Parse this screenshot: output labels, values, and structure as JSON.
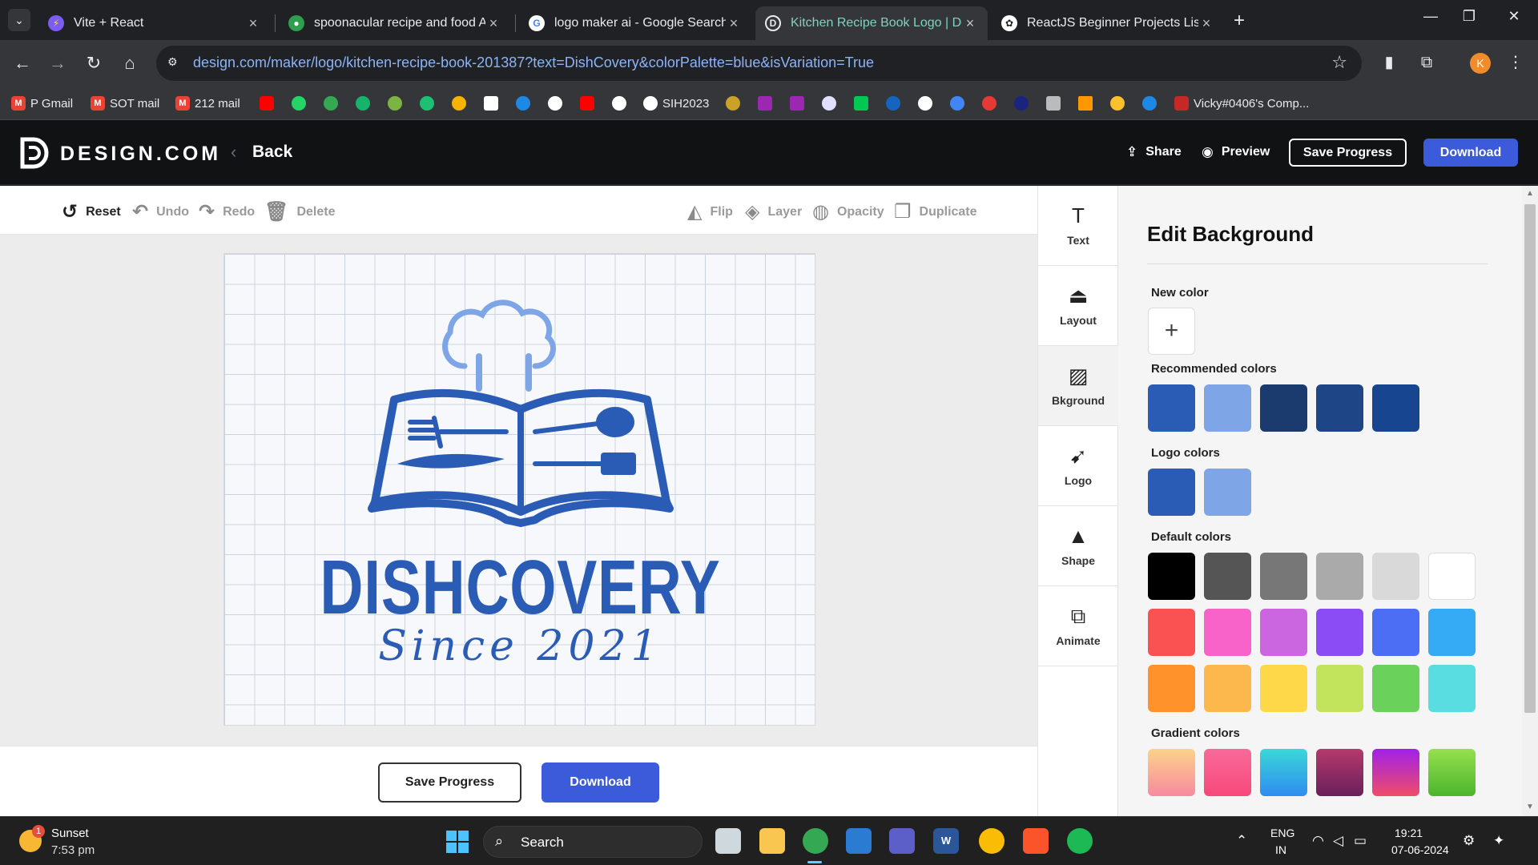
{
  "browser": {
    "tabs": [
      {
        "label": "Vite + React",
        "favicon": "vite-icon",
        "active": false
      },
      {
        "label": "spoonacular recipe and food API",
        "favicon": "spoonacular-icon",
        "active": false
      },
      {
        "label": "logo maker ai - Google Search",
        "favicon": "google-icon",
        "active": false
      },
      {
        "label": "Kitchen Recipe Book Logo | Design.com",
        "favicon": "design-com-icon",
        "active": true
      },
      {
        "label": "ReactJS Beginner Projects List",
        "favicon": "chatgpt-icon",
        "active": false
      }
    ],
    "url_host": "design.com",
    "url_path": "/maker/logo/kitchen-recipe-book-201387?text=DishCovery&colorPalette=blue&isVariation=True",
    "profile_initial": "K",
    "bookmarks": [
      {
        "label": "P Gmail",
        "icon": "gmail-icon"
      },
      {
        "label": "SOT mail",
        "icon": "gmail-icon"
      },
      {
        "label": "212 mail",
        "icon": "gmail-icon"
      },
      {
        "label": "SIH2023",
        "icon": "github-icon"
      },
      {
        "label": "Vicky#0406's Comp...",
        "icon": "extension-icon"
      }
    ]
  },
  "app": {
    "brand": "DESIGN.COM",
    "back_label": "Back",
    "share_label": "Share",
    "preview_label": "Preview",
    "save_progress_label": "Save Progress",
    "download_label": "Download"
  },
  "editor_toolbar": {
    "reset": "Reset",
    "undo": "Undo",
    "redo": "Redo",
    "delete": "Delete",
    "flip": "Flip",
    "layer": "Layer",
    "opacity": "Opacity",
    "duplicate": "Duplicate"
  },
  "logo": {
    "name": "DISHCOVERY",
    "tagline": "Since 2021",
    "primary_color": "#2a5bb5",
    "secondary_color": "#7ea6e6"
  },
  "bottom": {
    "save_progress_label": "Save Progress",
    "download_label": "Download"
  },
  "side_tools": [
    {
      "label": "Text",
      "icon": "text-icon",
      "active": false
    },
    {
      "label": "Layout",
      "icon": "layout-icon",
      "active": false
    },
    {
      "label": "Bkground",
      "icon": "background-icon",
      "active": true
    },
    {
      "label": "Logo",
      "icon": "logo-icon",
      "active": false
    },
    {
      "label": "Shape",
      "icon": "shape-icon",
      "active": false
    },
    {
      "label": "Animate",
      "icon": "animate-icon",
      "active": false
    }
  ],
  "panel": {
    "title": "Edit Background",
    "new_color_label": "New color",
    "recommended_label": "Recommended colors",
    "recommended_colors": [
      "#2a5bb5",
      "#7ea6e6",
      "#1b3b6f",
      "#1e4586",
      "#174590"
    ],
    "logo_colors_label": "Logo colors",
    "logo_colors": [
      "#2a5bb5",
      "#7ea6e6"
    ],
    "default_colors_label": "Default colors",
    "default_colors": [
      "#000000",
      "#555555",
      "#777777",
      "#aaaaaa",
      "#d9d9d9",
      "#ffffff",
      "#fa5252",
      "#f763c8",
      "#cc66e0",
      "#8b4cf5",
      "#4c6ef5",
      "#35aaf5",
      "#ff922b",
      "#fcb84c",
      "#ffd84a",
      "#c2e35c",
      "#6ad15a",
      "#59dde0"
    ],
    "gradient_colors_label": "Gradient colors",
    "gradient_colors": [
      [
        "#fcd38a",
        "#f78aa0"
      ],
      [
        "#f86a9a",
        "#f7487a"
      ],
      [
        "#3ad8d8",
        "#2f8cf0"
      ],
      [
        "#b53a6b",
        "#6a1f5c"
      ],
      [
        "#a021e8",
        "#f04c6a"
      ],
      [
        "#96e04e",
        "#4cb52e"
      ]
    ]
  },
  "taskbar": {
    "weather_title": "Sunset",
    "weather_sub": "7:53 pm",
    "weather_badge": "1",
    "search_label": "Search",
    "lang_line1": "ENG",
    "lang_line2": "IN",
    "time": "19:21",
    "date": "07-06-2024"
  }
}
